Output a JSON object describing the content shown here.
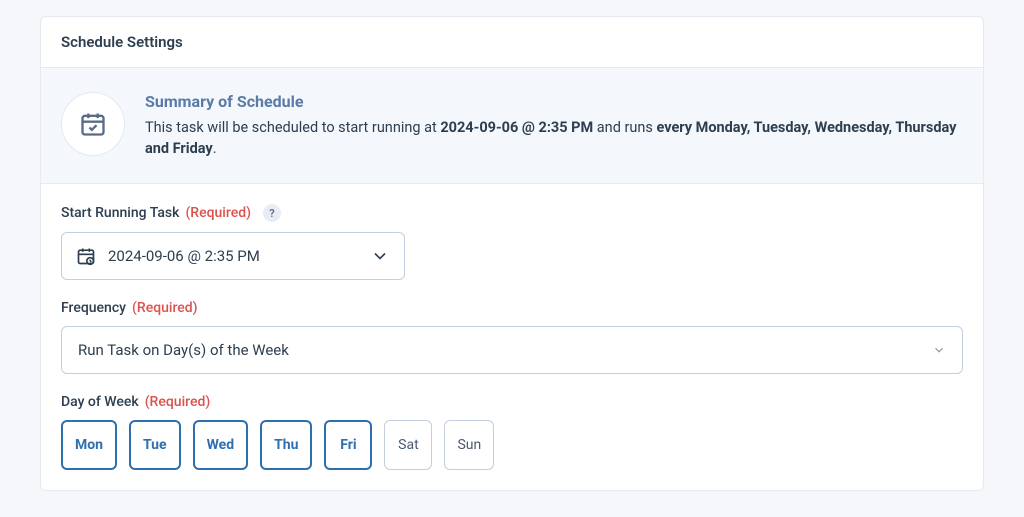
{
  "header": {
    "title": "Schedule Settings"
  },
  "summary": {
    "title": "Summary of Schedule",
    "prefix": "This task will be scheduled to start running at ",
    "datetime": "2024-09-06 @ 2:35 PM",
    "mid": " and runs ",
    "recurrence": "every Monday, Tuesday, Wednesday, Thursday and Friday",
    "suffix": "."
  },
  "fields": {
    "start": {
      "label": "Start Running Task",
      "required": "(Required)",
      "help": "?",
      "value": "2024-09-06 @ 2:35 PM"
    },
    "frequency": {
      "label": "Frequency",
      "required": "(Required)",
      "value": "Run Task on Day(s) of the Week"
    },
    "dayofweek": {
      "label": "Day of Week",
      "required": "(Required)",
      "days": [
        {
          "label": "Mon",
          "selected": true
        },
        {
          "label": "Tue",
          "selected": true
        },
        {
          "label": "Wed",
          "selected": true
        },
        {
          "label": "Thu",
          "selected": true
        },
        {
          "label": "Fri",
          "selected": true
        },
        {
          "label": "Sat",
          "selected": false
        },
        {
          "label": "Sun",
          "selected": false
        }
      ]
    }
  }
}
